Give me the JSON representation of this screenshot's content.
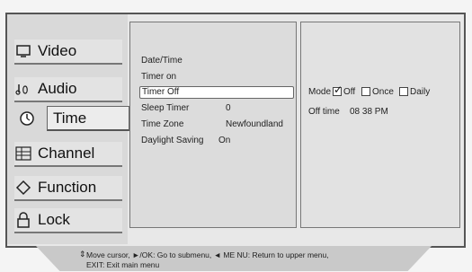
{
  "menu": {
    "items": [
      {
        "label": "Video",
        "icon": "video-screen-icon"
      },
      {
        "label": "Audio",
        "icon": "audio-notes-icon"
      },
      {
        "label": "Time",
        "icon": "clock-icon"
      },
      {
        "label": "Channel",
        "icon": "channel-grid-icon"
      },
      {
        "label": "Function",
        "icon": "function-diamond-icon"
      },
      {
        "label": "Lock",
        "icon": "lock-icon"
      }
    ],
    "active": "Time"
  },
  "submenu": {
    "date_time": "Date/Time",
    "timer_on": "Timer on",
    "timer_off": "Timer Off",
    "sleep_timer": {
      "label": "Sleep Timer",
      "value": "0"
    },
    "time_zone": {
      "label": "Time Zone",
      "value": "Newfoundland"
    },
    "daylight_saving": {
      "label": "Daylight Saving",
      "value": "On"
    }
  },
  "detail": {
    "mode_label": "Mode",
    "off_label": "Off",
    "once_label": "Once",
    "daily_label": "Daily",
    "off_checked": true,
    "offtime_label": "Off time",
    "offtime_value": "08 38 PM"
  },
  "help": {
    "line1": "Move cursor, ►/OK: Go to submenu, ◄ ME NU: Return to upper menu,",
    "line2": "EXIT: Exit main menu"
  }
}
